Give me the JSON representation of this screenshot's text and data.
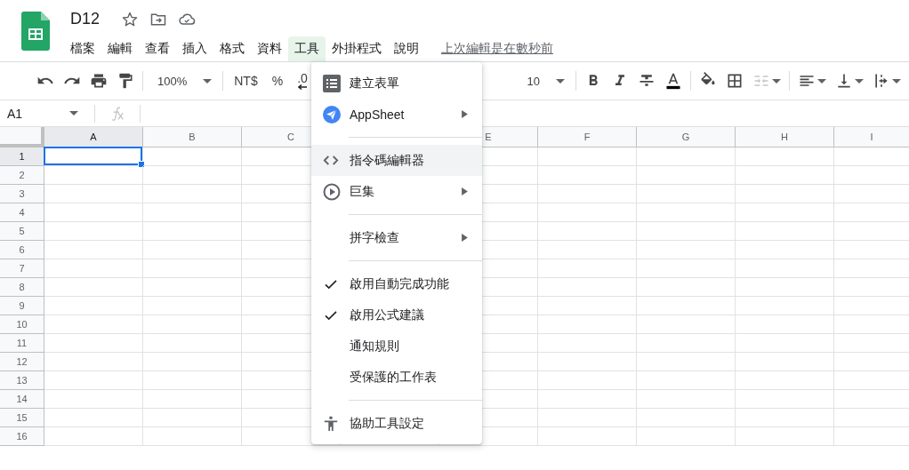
{
  "document": {
    "title": "D12",
    "last_edit": "上次編輯是在數秒前"
  },
  "menubar": [
    {
      "label": "檔案",
      "selected": false
    },
    {
      "label": "編輯",
      "selected": false
    },
    {
      "label": "查看",
      "selected": false
    },
    {
      "label": "插入",
      "selected": false
    },
    {
      "label": "格式",
      "selected": false
    },
    {
      "label": "資料",
      "selected": false
    },
    {
      "label": "工具",
      "selected": true
    },
    {
      "label": "外掛程式",
      "selected": false
    },
    {
      "label": "說明",
      "selected": false
    }
  ],
  "toolbar_left": [
    {
      "kind": "undo"
    },
    {
      "kind": "redo"
    },
    {
      "kind": "print"
    },
    {
      "kind": "paint"
    },
    {
      "kind": "sep"
    },
    {
      "kind": "dropdown",
      "label": "100%"
    },
    {
      "kind": "sep"
    },
    {
      "kind": "text",
      "label": "NT$"
    },
    {
      "kind": "text",
      "label": "%"
    },
    {
      "kind": "decimal",
      "label": ".0"
    }
  ],
  "toolbar_right": [
    {
      "kind": "dropdown",
      "label": "10"
    },
    {
      "kind": "sep"
    },
    {
      "kind": "bold"
    },
    {
      "kind": "italic"
    },
    {
      "kind": "strike"
    },
    {
      "kind": "textcolor"
    },
    {
      "kind": "sep"
    },
    {
      "kind": "fill"
    },
    {
      "kind": "borders"
    },
    {
      "kind": "merge",
      "disabled": true
    },
    {
      "kind": "sep"
    },
    {
      "kind": "align"
    },
    {
      "kind": "valign"
    },
    {
      "kind": "rotate"
    }
  ],
  "name_box": "A1",
  "columns": [
    {
      "label": "A",
      "selected": true
    },
    {
      "label": "B",
      "selected": false
    },
    {
      "label": "C",
      "selected": false
    },
    {},
    {
      "label": "E",
      "selected": false
    },
    {
      "label": "F",
      "selected": false
    },
    {
      "label": "G",
      "selected": false
    },
    {
      "label": "H",
      "selected": false
    },
    {
      "label": "I",
      "selected": false
    }
  ],
  "rows": [
    {
      "label": "1",
      "selected": true
    },
    {
      "label": "2",
      "selected": false
    },
    {
      "label": "3",
      "selected": false
    },
    {
      "label": "4",
      "selected": false
    },
    {
      "label": "5",
      "selected": false
    },
    {
      "label": "6",
      "selected": false
    },
    {
      "label": "7",
      "selected": false
    },
    {
      "label": "8",
      "selected": false
    },
    {
      "label": "9",
      "selected": false
    },
    {
      "label": "10",
      "selected": false
    },
    {
      "label": "11",
      "selected": false
    },
    {
      "label": "12",
      "selected": false
    },
    {
      "label": "13",
      "selected": false
    },
    {
      "label": "14",
      "selected": false
    },
    {
      "label": "15",
      "selected": false
    },
    {
      "label": "16",
      "selected": false
    }
  ],
  "menu": {
    "items": [
      {
        "kind": "form",
        "label": "建立表單",
        "submenu": false,
        "checked": false,
        "selected": false
      },
      {
        "kind": "appsheet",
        "label": "AppSheet",
        "submenu": true,
        "checked": false,
        "selected": false
      },
      {
        "kind": "separator"
      },
      {
        "kind": "code",
        "label": "指令碼編輯器",
        "submenu": false,
        "checked": false,
        "selected": true
      },
      {
        "kind": "macro",
        "label": "巨集",
        "submenu": true,
        "checked": false,
        "selected": false
      },
      {
        "kind": "separator"
      },
      {
        "kind": "plain",
        "label": "拼字檢查",
        "submenu": true,
        "checked": false,
        "selected": false
      },
      {
        "kind": "separator"
      },
      {
        "kind": "plain",
        "label": "啟用自動完成功能",
        "submenu": false,
        "checked": true,
        "selected": false
      },
      {
        "kind": "plain",
        "label": "啟用公式建議",
        "submenu": false,
        "checked": true,
        "selected": false
      },
      {
        "kind": "plain",
        "label": "通知規則",
        "submenu": false,
        "checked": false,
        "selected": false
      },
      {
        "kind": "plain",
        "label": "受保護的工作表",
        "submenu": false,
        "checked": false,
        "selected": false
      },
      {
        "kind": "separator"
      },
      {
        "kind": "accessibility",
        "label": "協助工具設定",
        "submenu": false,
        "checked": false,
        "selected": false
      }
    ]
  }
}
